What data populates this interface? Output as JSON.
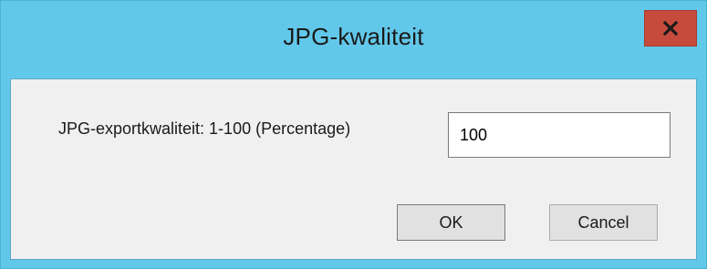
{
  "window": {
    "title": "JPG-kwaliteit",
    "accent_color": "#62c8ea",
    "close_color": "#c74b3d",
    "close_icon": "close-icon"
  },
  "form": {
    "label": "JPG-exportkwaliteit: 1-100 (Percentage)",
    "quality_value": "100"
  },
  "buttons": {
    "ok_label": "OK",
    "cancel_label": "Cancel"
  }
}
